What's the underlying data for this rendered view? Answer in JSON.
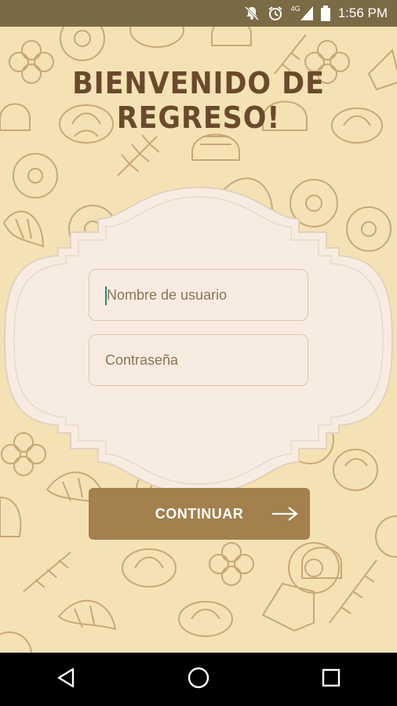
{
  "status_bar": {
    "time": "1:56 PM",
    "network": "4G",
    "icons": [
      "notifications-off-icon",
      "alarm-icon",
      "signal-icon",
      "battery-icon"
    ]
  },
  "login": {
    "title": "BIENVENIDO DE REGRESO!",
    "username_placeholder": "Nombre de usuario",
    "password_placeholder": "Contraseña",
    "continue_label": "CONTINUAR"
  },
  "nav_bar": {
    "icons": [
      "back-icon",
      "home-icon",
      "recents-icon"
    ]
  },
  "colors": {
    "background": "#f4e2b4",
    "frame": "#f8ece2",
    "button": "#a3804e",
    "title": "#6b4a2c",
    "cursor": "#21897a"
  }
}
